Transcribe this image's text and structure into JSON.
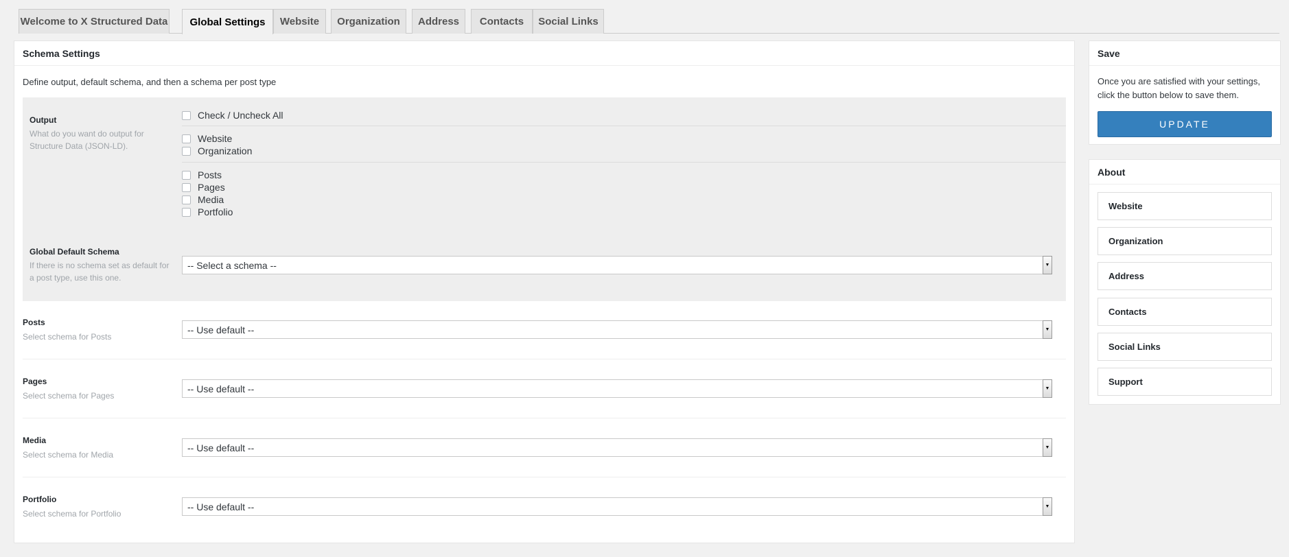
{
  "tabs": [
    {
      "label": "Welcome to X Structured Data",
      "active": false
    },
    {
      "label": "Global Settings",
      "active": true
    },
    {
      "label": "Website",
      "active": false
    },
    {
      "label": "Organization",
      "active": false
    },
    {
      "label": "Address",
      "active": false
    },
    {
      "label": "Contacts",
      "active": false
    },
    {
      "label": "Social Links",
      "active": false
    }
  ],
  "main": {
    "title": "Schema Settings",
    "intro": "Define output, default schema, and then a schema per post type",
    "output": {
      "label": "Output",
      "description": "What do you want do output for Structure Data (JSON-LD).",
      "check_all": "Check / Uncheck All",
      "group1": [
        "Website",
        "Organization"
      ],
      "group2": [
        "Posts",
        "Pages",
        "Media",
        "Portfolio"
      ]
    },
    "global_default": {
      "label": "Global Default Schema",
      "description": "If there is no schema set as default for a post type, use this one.",
      "value": "-- Select a schema --"
    },
    "post_types": [
      {
        "label": "Posts",
        "description": "Select schema for Posts",
        "value": "-- Use default --"
      },
      {
        "label": "Pages",
        "description": "Select schema for Pages",
        "value": "-- Use default --"
      },
      {
        "label": "Media",
        "description": "Select schema for Media",
        "value": "-- Use default --"
      },
      {
        "label": "Portfolio",
        "description": "Select schema for Portfolio",
        "value": "-- Use default --"
      }
    ]
  },
  "save": {
    "title": "Save",
    "text": "Once you are satisfied with your settings, click the button below to save them.",
    "button": "UPDATE"
  },
  "about": {
    "title": "About",
    "items": [
      "Website",
      "Organization",
      "Address",
      "Contacts",
      "Social Links",
      "Support"
    ]
  },
  "colors": {
    "accent": "#3580bd",
    "background": "#f1f1f1"
  }
}
